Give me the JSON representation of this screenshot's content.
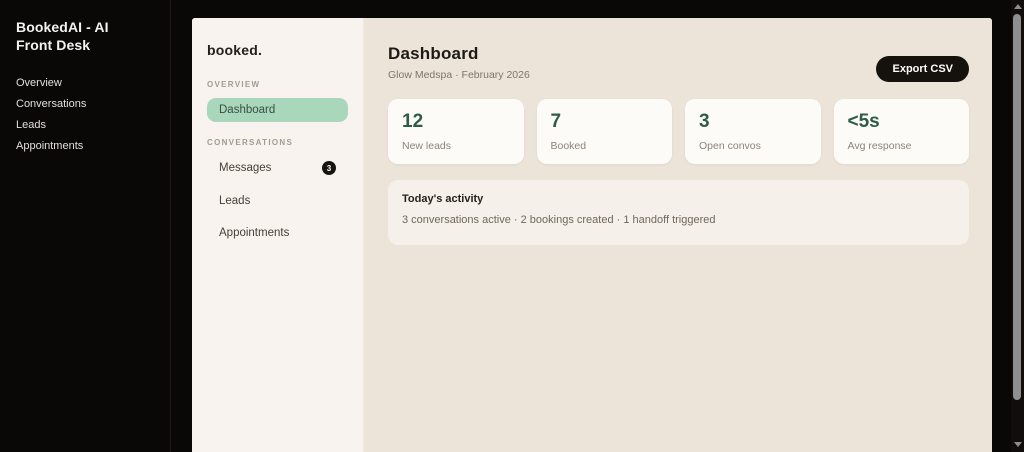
{
  "app": {
    "window_title": "BookedAI - AI Front Desk",
    "nav": [
      {
        "label": "Overview"
      },
      {
        "label": "Conversations"
      },
      {
        "label": "Leads"
      },
      {
        "label": "Appointments"
      }
    ]
  },
  "sidebar": {
    "logo": "booked.",
    "sections": [
      {
        "label": "OVERVIEW",
        "items": [
          {
            "label": "Dashboard",
            "active": true
          }
        ]
      },
      {
        "label": "CONVERSATIONS",
        "items": [
          {
            "label": "Messages",
            "badge": "3"
          },
          {
            "label": "Leads"
          },
          {
            "label": "Appointments"
          }
        ]
      }
    ]
  },
  "main": {
    "title": "Dashboard",
    "subtitle": "Glow Medspa · February 2026",
    "export_button_label": "Export CSV",
    "stats": [
      {
        "value": "12",
        "label": "New leads"
      },
      {
        "value": "7",
        "label": "Booked"
      },
      {
        "value": "3",
        "label": "Open convos"
      },
      {
        "value": "<5s",
        "label": "Avg response"
      }
    ],
    "activity": {
      "title": "Today's activity",
      "text": "3 conversations active · 2 bookings created · 1 handoff triggered"
    }
  },
  "colors": {
    "frame_background": "#0a0807",
    "window_background": "#f8f3ee",
    "main_background": "#ece4d9",
    "card_background": "#fdfbf8",
    "activity_background": "#f6f0ea",
    "active_pill": "#a8d7bc",
    "stat_value": "#2e5c49",
    "button_background": "#15110d",
    "badge_background": "#17130f"
  }
}
